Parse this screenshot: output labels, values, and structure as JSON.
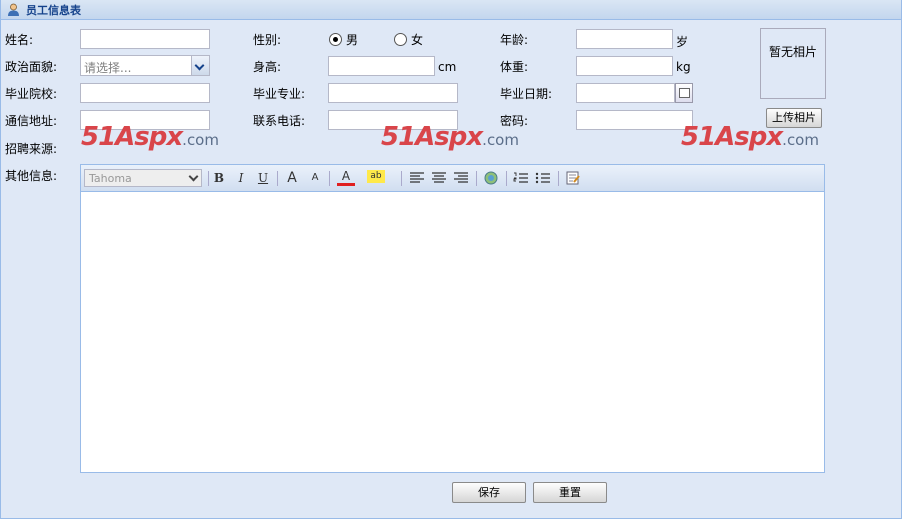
{
  "panel": {
    "title": "员工信息表"
  },
  "form": {
    "name": {
      "label": "姓名:",
      "value": ""
    },
    "gender": {
      "label": "性别:",
      "male": "男",
      "female": "女",
      "selected": "男"
    },
    "age": {
      "label": "年龄:",
      "value": "",
      "unit": "岁"
    },
    "political": {
      "label": "政治面貌:",
      "placeholder": "请选择..."
    },
    "height": {
      "label": "身高:",
      "value": "",
      "unit": "cm"
    },
    "weight": {
      "label": "体重:",
      "value": "",
      "unit": "kg"
    },
    "school": {
      "label": "毕业院校:",
      "value": ""
    },
    "major": {
      "label": "毕业专业:",
      "value": ""
    },
    "grad_date": {
      "label": "毕业日期:",
      "value": ""
    },
    "address": {
      "label": "通信地址:",
      "value": ""
    },
    "phone": {
      "label": "联系电话:",
      "value": ""
    },
    "password": {
      "label": "密码:",
      "value": ""
    },
    "source": {
      "label": "招聘来源:"
    },
    "other": {
      "label": "其他信息:"
    }
  },
  "photo": {
    "placeholder": "暂无相片",
    "upload_label": "上传相片"
  },
  "watermark": {
    "main": "51Aspx",
    "suffix": ".com"
  },
  "editor": {
    "font": "Tahoma",
    "tools": [
      "bold-icon",
      "italic-icon",
      "underline-icon",
      "font-grow-icon",
      "font-shrink-icon",
      "font-color-icon",
      "highlight-icon",
      "align-left-icon",
      "align-center-icon",
      "align-right-icon",
      "insert-link-icon",
      "ordered-list-icon",
      "unordered-list-icon",
      "source-edit-icon"
    ],
    "glyphs": {
      "bold": "B",
      "italic": "I",
      "underline": "U",
      "grow": "A",
      "shrink": "A",
      "color": "A",
      "highlight": "ab"
    }
  },
  "actions": {
    "save": "保存",
    "reset": "重置"
  },
  "colors": {
    "title": "#15428b",
    "watermark": "#d9454a",
    "panel_bg": "#dfe8f6",
    "border": "#99bbe8"
  }
}
